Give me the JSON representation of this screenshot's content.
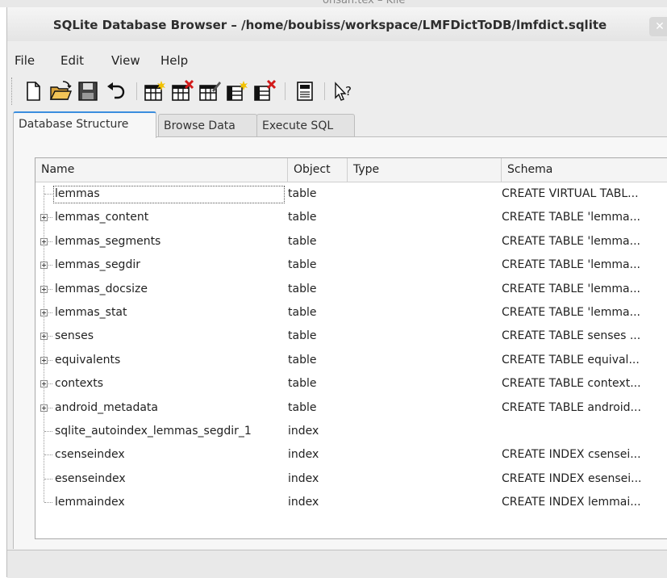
{
  "background_window": {
    "title": "ohsah.tex – Kile"
  },
  "window": {
    "title": "SQLite Database Browser – /home/boubiss/workspace/LMFDictToDB/lmfdict.sqlite"
  },
  "menu": [
    {
      "label": "File"
    },
    {
      "label": "Edit"
    },
    {
      "label": "View"
    },
    {
      "label": "Help"
    }
  ],
  "toolbar": [
    {
      "icon": "new-database-icon"
    },
    {
      "icon": "open-database-icon"
    },
    {
      "icon": "save-icon"
    },
    {
      "icon": "undo-icon"
    },
    {
      "icon": "create-table-icon"
    },
    {
      "icon": "delete-table-icon"
    },
    {
      "icon": "modify-table-icon"
    },
    {
      "icon": "create-index-icon"
    },
    {
      "icon": "delete-index-icon"
    },
    {
      "icon": "sql-log-icon"
    },
    {
      "icon": "whats-this-icon"
    }
  ],
  "tabs": [
    {
      "label": "Database Structure",
      "active": true
    },
    {
      "label": "Browse Data",
      "active": false
    },
    {
      "label": "Execute SQL",
      "active": false
    }
  ],
  "tree": {
    "columns": [
      "Name",
      "Object",
      "Type",
      "Schema"
    ],
    "rows": [
      {
        "name": "lemmas",
        "object": "table",
        "type": "",
        "schema": "CREATE VIRTUAL TABL...",
        "expandable": false
      },
      {
        "name": "lemmas_content",
        "object": "table",
        "type": "",
        "schema": "CREATE TABLE 'lemma...",
        "expandable": true
      },
      {
        "name": "lemmas_segments",
        "object": "table",
        "type": "",
        "schema": "CREATE TABLE 'lemma...",
        "expandable": true
      },
      {
        "name": "lemmas_segdir",
        "object": "table",
        "type": "",
        "schema": "CREATE TABLE 'lemma...",
        "expandable": true
      },
      {
        "name": "lemmas_docsize",
        "object": "table",
        "type": "",
        "schema": "CREATE TABLE 'lemma...",
        "expandable": true
      },
      {
        "name": "lemmas_stat",
        "object": "table",
        "type": "",
        "schema": "CREATE TABLE 'lemma...",
        "expandable": true
      },
      {
        "name": "senses",
        "object": "table",
        "type": "",
        "schema": "CREATE TABLE senses ...",
        "expandable": true
      },
      {
        "name": "equivalents",
        "object": "table",
        "type": "",
        "schema": "CREATE TABLE equival...",
        "expandable": true
      },
      {
        "name": "contexts",
        "object": "table",
        "type": "",
        "schema": "CREATE TABLE context...",
        "expandable": true
      },
      {
        "name": "android_metadata",
        "object": "table",
        "type": "",
        "schema": "CREATE TABLE android...",
        "expandable": true
      },
      {
        "name": "sqlite_autoindex_lemmas_segdir_1",
        "object": "index",
        "type": "",
        "schema": "",
        "expandable": false
      },
      {
        "name": "csenseindex",
        "object": "index",
        "type": "",
        "schema": "CREATE INDEX csensei...",
        "expandable": false
      },
      {
        "name": "esenseindex",
        "object": "index",
        "type": "",
        "schema": "CREATE INDEX esensei...",
        "expandable": false
      },
      {
        "name": "lemmaindex",
        "object": "index",
        "type": "",
        "schema": "CREATE INDEX lemmai...",
        "expandable": false
      }
    ]
  }
}
